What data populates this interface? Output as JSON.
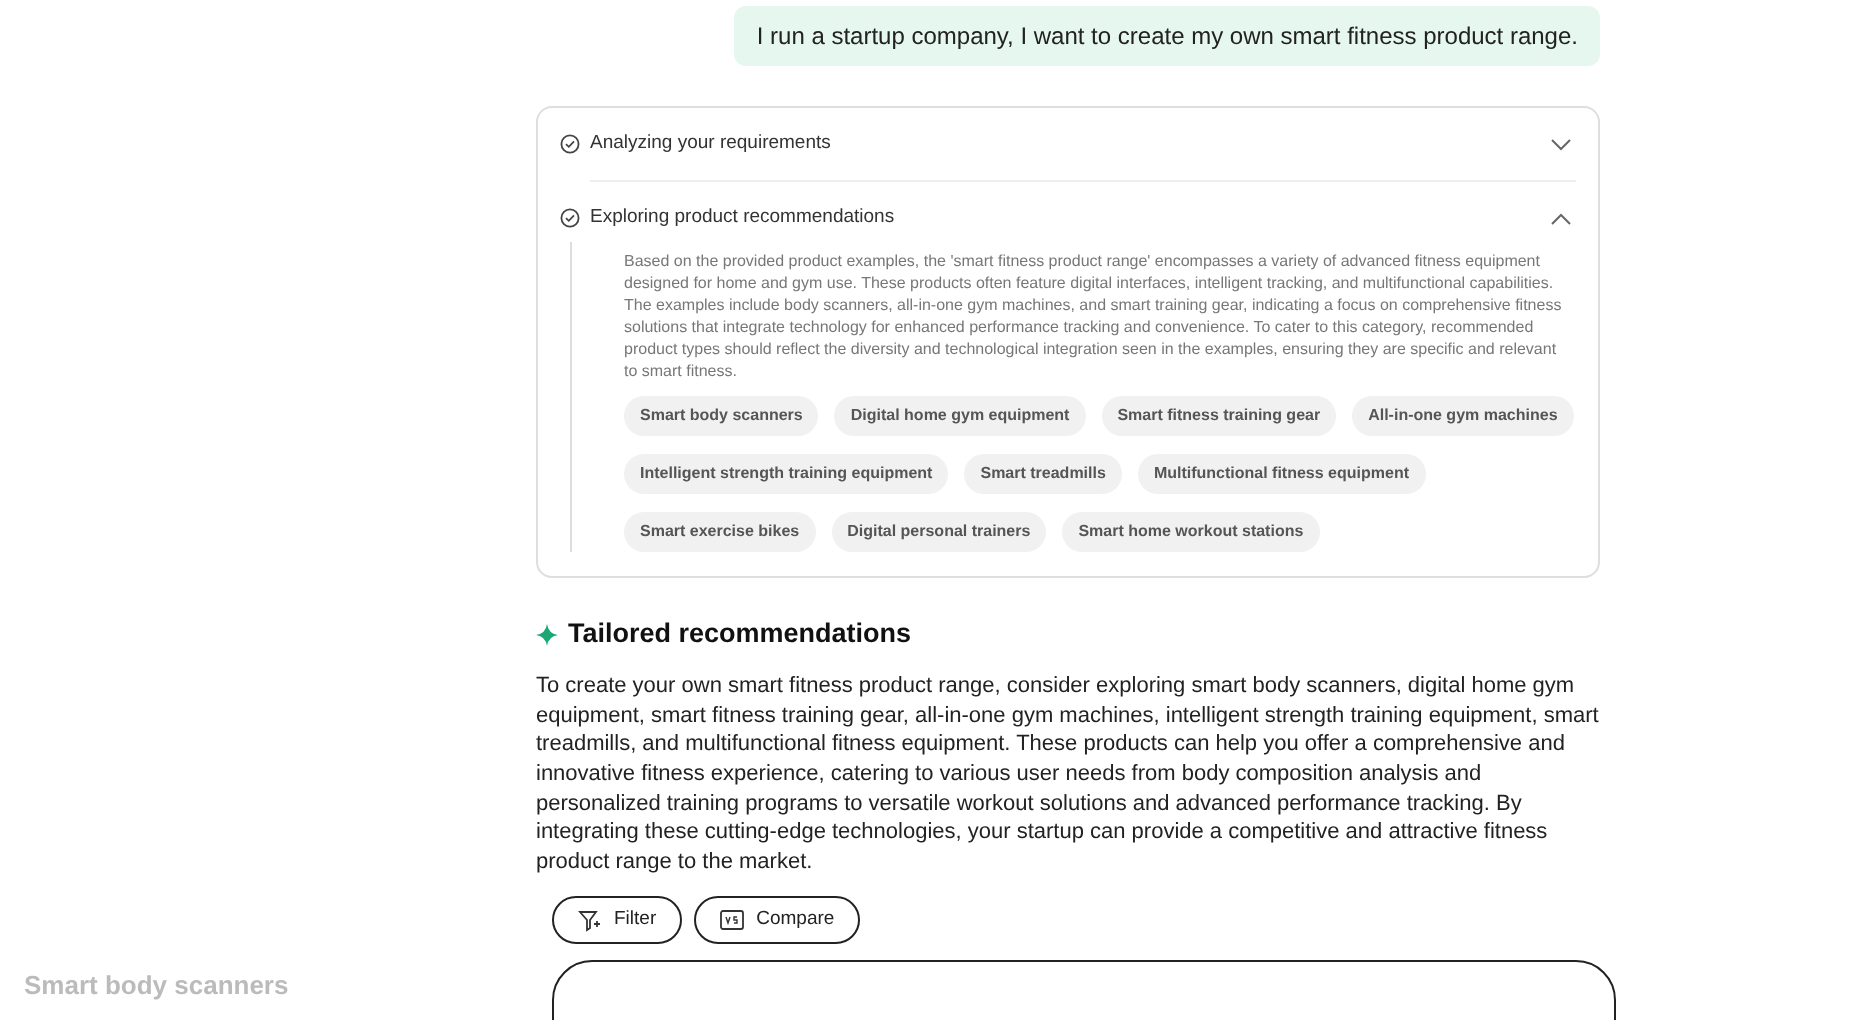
{
  "user_message": "I run a startup company, I want to create my own smart fitness product range.",
  "steps": [
    {
      "title": "Analyzing your requirements",
      "expanded": false
    },
    {
      "title": "Exploring product recommendations",
      "expanded": true,
      "body": "Based on the provided product examples, the 'smart fitness product range' encompasses a variety of advanced fitness equipment designed for home and gym use. These products often feature digital interfaces, intelligent tracking, and multifunctional capabilities. The examples include body scanners, all-in-one gym machines, and smart training gear, indicating a focus on comprehensive fitness solutions that integrate technology for enhanced performance tracking and convenience. To cater to this category, recommended product types should reflect the diversity and technological integration seen in the examples, ensuring they are specific and relevant to smart fitness.",
      "chips": [
        "Smart body scanners",
        "Digital home gym equipment",
        "Smart fitness training gear",
        "All-in-one gym machines",
        "Intelligent strength training equipment",
        "Smart treadmills",
        "Multifunctional fitness equipment",
        "Smart exercise bikes",
        "Digital personal trainers",
        "Smart home workout stations"
      ]
    }
  ],
  "recommendations": {
    "title": "Tailored recommendations",
    "text": "To create your own smart fitness product range, consider exploring smart body scanners, digital home gym equipment, smart fitness training gear, all-in-one gym machines, intelligent strength training equipment, smart treadmills, and multifunctional fitness equipment. These products can help you offer a comprehensive and innovative fitness experience, catering to various user needs from body composition analysis and personalized training programs to versatile workout solutions and advanced performance tracking. By integrating these cutting-edge technologies, your startup can provide a competitive and attractive fitness product range to the market."
  },
  "actions": [
    {
      "kind": "filter",
      "label": "Filter"
    },
    {
      "kind": "compare",
      "label": "Compare"
    }
  ],
  "section_label": "Smart body scanners"
}
